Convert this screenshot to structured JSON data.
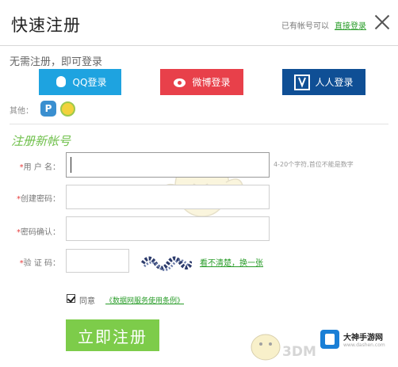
{
  "header": {
    "title": "快速注册",
    "has_account_text": "已有帐号可以",
    "login_link": "直接登录"
  },
  "social": {
    "prompt": "无需注册，即可登录",
    "qq_label": "QQ登录",
    "weibo_label": "微博登录",
    "renren_label": "人人登录",
    "other_label": "其他："
  },
  "form": {
    "section_title": "注册新帐号",
    "username_label": "用 户 名：",
    "username_hint": "4-20个字符,首位不能是数字",
    "password_label": "创建密码：",
    "confirm_label": "密码确认：",
    "captcha_label": "验 证 码：",
    "refresh_link": "看不清楚，换一张",
    "agree_text": "同意",
    "agree_link": "《数据网服务使用条例》",
    "submit_label": "立即注册"
  },
  "watermark": {
    "brand": "3DM",
    "badge_title": "大神手游网",
    "badge_sub": "www.dashen.com"
  },
  "colors": {
    "qq": "#1ea3e0",
    "weibo": "#e8404a",
    "renren": "#0f4f95",
    "accent_green": "#7dcc4a",
    "link_green": "#2a9d2a"
  }
}
